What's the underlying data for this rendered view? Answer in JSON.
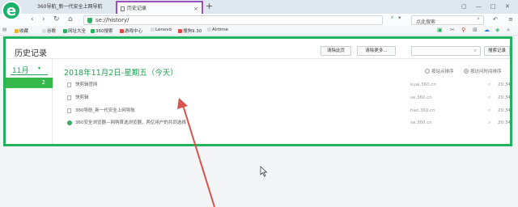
{
  "tabs": [
    {
      "label": "360导航_新一代安全上网导航",
      "active": false
    },
    {
      "label": "历史记录",
      "active": true
    }
  ],
  "address": {
    "url": "se://history/",
    "search_placeholder": "点此搜索"
  },
  "bookmarks": [
    {
      "label": "收藏",
      "color": "#e8b82a"
    },
    {
      "label": "谷歌",
      "color": "#d9dde1"
    },
    {
      "label": "网址大全",
      "color": "#2fb061"
    },
    {
      "label": "360搜索",
      "color": "#2fb061"
    },
    {
      "label": "游戏中心",
      "color": "#e04646"
    },
    {
      "label": "Lenovo",
      "color": "#d9dde1"
    },
    {
      "label": "搜狗9.30",
      "color": "#e04646"
    },
    {
      "label": "Airtime",
      "color": "#d9dde1"
    }
  ],
  "history": {
    "title": "历史记录",
    "clear_page_label": "清除此页",
    "clear_more_label": "清除更多...",
    "search_button_label": "搜索记录",
    "month": "11月",
    "day": "2",
    "date_heading": "2018年11月2日-星期五（今天）",
    "sort_by_site": "按站点排序",
    "sort_by_time": "按访问时间排序",
    "items": [
      {
        "title": "快剪辑官网",
        "domain": "kuai.360.cn",
        "time": "20:34",
        "icon": "page"
      },
      {
        "title": "快剪辑",
        "domain": "se.360.cn",
        "time": "20:34",
        "icon": "page"
      },
      {
        "title": "360导航_新一代安全上网导航",
        "domain": "hao.360.cn",
        "time": "20:34",
        "icon": "page"
      },
      {
        "title": "360安全浏览器—网购首选浏览器，两亿用户的共同选择",
        "domain": "se.360.cn",
        "time": "20:34",
        "icon": "green"
      }
    ]
  },
  "colors": {
    "accent": "#22b35e",
    "tab_highlight": "#9b4fc0",
    "annotation_arrow": "#d9534f"
  }
}
